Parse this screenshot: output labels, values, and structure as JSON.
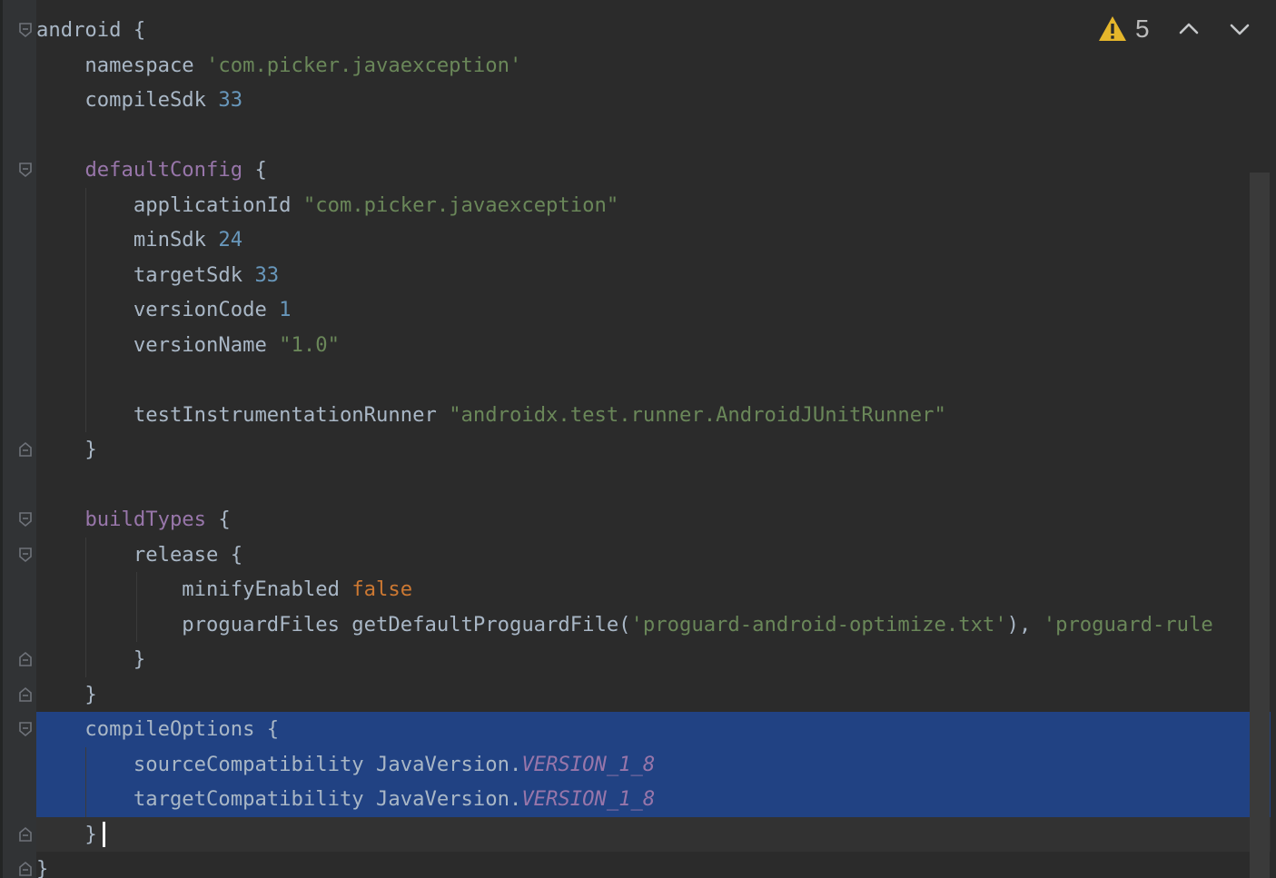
{
  "inspection": {
    "warning_count": "5"
  },
  "code": {
    "lines": [
      [
        {
          "t": "android {",
          "c": "plain"
        }
      ],
      [
        {
          "t": "    namespace ",
          "c": "plain"
        },
        {
          "t": "'com.picker.javaexception'",
          "c": "str"
        }
      ],
      [
        {
          "t": "    compileSdk ",
          "c": "plain"
        },
        {
          "t": "33",
          "c": "num"
        }
      ],
      [],
      [
        {
          "t": "    ",
          "c": "plain"
        },
        {
          "t": "defaultConfig",
          "c": "prop"
        },
        {
          "t": " {",
          "c": "plain"
        }
      ],
      [
        {
          "t": "        applicationId ",
          "c": "plain"
        },
        {
          "t": "\"com.picker.javaexception\"",
          "c": "str"
        }
      ],
      [
        {
          "t": "        minSdk ",
          "c": "plain"
        },
        {
          "t": "24",
          "c": "num"
        }
      ],
      [
        {
          "t": "        targetSdk ",
          "c": "plain"
        },
        {
          "t": "33",
          "c": "num"
        }
      ],
      [
        {
          "t": "        versionCode ",
          "c": "plain"
        },
        {
          "t": "1",
          "c": "num"
        }
      ],
      [
        {
          "t": "        versionName ",
          "c": "plain"
        },
        {
          "t": "\"1.0\"",
          "c": "str"
        }
      ],
      [],
      [
        {
          "t": "        testInstrumentationRunner ",
          "c": "plain"
        },
        {
          "t": "\"androidx.test.runner.AndroidJUnitRunner\"",
          "c": "str"
        }
      ],
      [
        {
          "t": "    }",
          "c": "plain"
        }
      ],
      [],
      [
        {
          "t": "    ",
          "c": "plain"
        },
        {
          "t": "buildTypes",
          "c": "prop"
        },
        {
          "t": " {",
          "c": "plain"
        }
      ],
      [
        {
          "t": "        release {",
          "c": "plain"
        }
      ],
      [
        {
          "t": "            minifyEnabled ",
          "c": "plain"
        },
        {
          "t": "false",
          "c": "kw"
        }
      ],
      [
        {
          "t": "            proguardFiles getDefaultProguardFile(",
          "c": "plain"
        },
        {
          "t": "'proguard-android-optimize.txt'",
          "c": "str"
        },
        {
          "t": "), ",
          "c": "plain"
        },
        {
          "t": "'proguard-rule",
          "c": "str"
        }
      ],
      [
        {
          "t": "        }",
          "c": "plain"
        }
      ],
      [
        {
          "t": "    }",
          "c": "plain"
        }
      ],
      [
        {
          "t": "    compileOptions {",
          "c": "plain"
        }
      ],
      [
        {
          "t": "        sourceCompatibility JavaVersion.",
          "c": "plain"
        },
        {
          "t": "VERSION_1_8",
          "c": "const"
        }
      ],
      [
        {
          "t": "        targetCompatibility JavaVersion.",
          "c": "plain"
        },
        {
          "t": "VERSION_1_8",
          "c": "const"
        }
      ],
      [
        {
          "t": "    }",
          "c": "plain"
        }
      ],
      [
        {
          "t": "}",
          "c": "plain"
        }
      ]
    ]
  }
}
